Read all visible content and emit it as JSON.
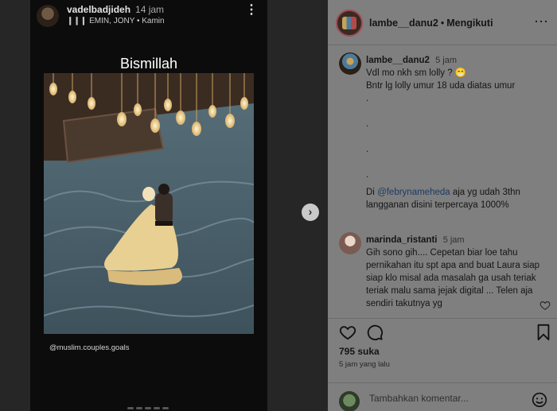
{
  "story": {
    "username": "vadelbadjideh",
    "time": "14 jam",
    "music": "EMIN, JONY • Kamin",
    "music_icon": "bars-icon",
    "title": "Bismillah",
    "credit": "@muslim.couples.goals"
  },
  "post": {
    "username": "lambe__danu2",
    "separator": "•",
    "follow_label": "Mengikuti",
    "more_icon": "more-icon"
  },
  "comments": [
    {
      "username": "lambe__danu2",
      "time": "5 jam",
      "line1": "Vdl mo nkh sm lolly ? 😁",
      "line2": "Bntr lg lolly umur 18 uda diatas umur",
      "dots": [
        ".",
        ".",
        ".",
        "."
      ],
      "line3_pre": "Di ",
      "mention": "@febrynameheda",
      "line3_post": " aja yg udah 3thn",
      "line4": "langganan disini terpercaya 1000%"
    },
    {
      "username": "marinda_ristanti",
      "time": "5 jam",
      "text": "Gih sono gih.... Cepetan biar loe tahu pernikahan itu spt apa and buat Laura siap siap klo misal ada masalah ga usah teriak teriak malu sama jejak digital ... Telen aja sendiri takutnya yg"
    }
  ],
  "likes": "795 suka",
  "post_time": "5 jam yang lalu",
  "add_comment": {
    "placeholder": "Tambahkan komentar..."
  },
  "colors": {
    "panel": "#7f7f7f",
    "overlay": "#262626",
    "story": "#0c0c0c"
  }
}
